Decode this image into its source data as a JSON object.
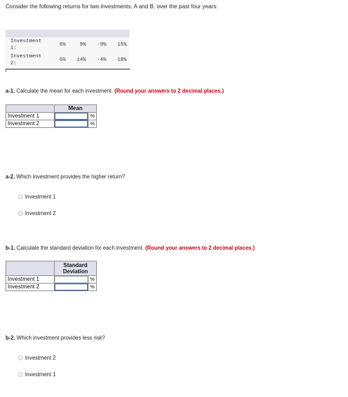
{
  "intro": "Consider the following returns for two investments, A and B, over the past four years:",
  "returns_table": {
    "rows": [
      {
        "label_line1": "Investment",
        "label_line2": "1:",
        "values": [
          "6%",
          "9%",
          "-9%",
          "15%"
        ]
      },
      {
        "label_line1": "Investment",
        "label_line2": "2:",
        "values": [
          "6%",
          "14%",
          "-4%",
          "18%"
        ]
      }
    ]
  },
  "a1": {
    "number": "a-1.",
    "text": "Calculate the mean for each investment.",
    "hint": "(Round your answers to 2 decimal places.)",
    "column_header": "Mean",
    "rows": [
      {
        "label": "Investment 1",
        "value": "",
        "unit": "%"
      },
      {
        "label": "Investment 2",
        "value": "",
        "unit": "%"
      }
    ]
  },
  "a2": {
    "number": "a-2.",
    "text": "Which investment provides the higher return?",
    "options": [
      "Investment 1",
      "Investment 2"
    ]
  },
  "b1": {
    "number": "b-1.",
    "text": "Calculate the standard deviation for each investment.",
    "hint": "(Round your answers to 2 decimal places.)",
    "column_header_line1": "Standard",
    "column_header_line2": "Deviation",
    "rows": [
      {
        "label": "Investment 1",
        "value": "",
        "unit": "%"
      },
      {
        "label": "Investment 2",
        "value": "",
        "unit": "%"
      }
    ]
  },
  "b2": {
    "number": "b-2.",
    "text": "Which investment provides less risk?",
    "options": [
      "Investment 2",
      "Investment 1"
    ]
  }
}
